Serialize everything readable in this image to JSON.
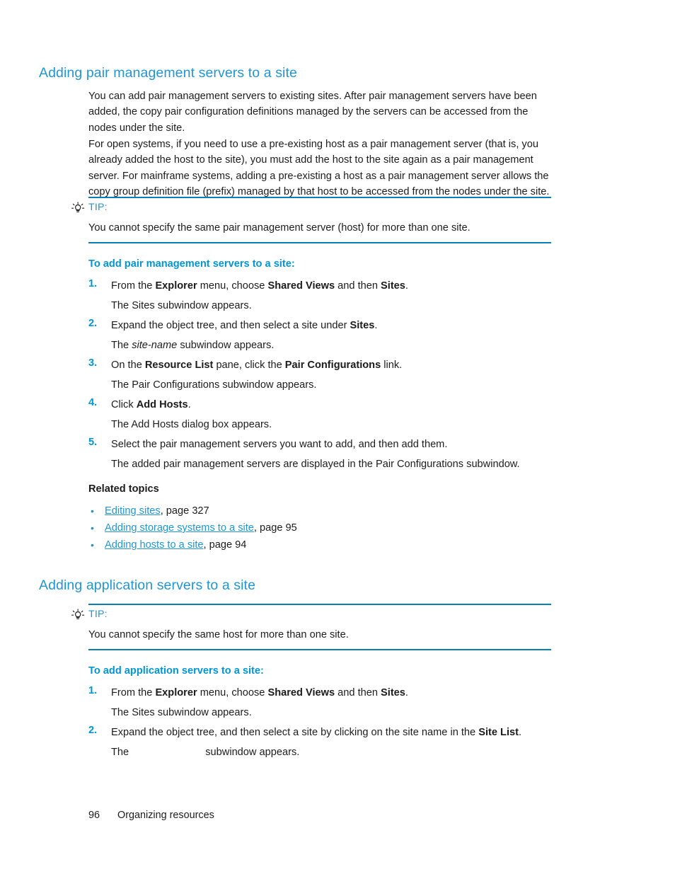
{
  "colors": {
    "heading_blue": "#2196d4",
    "accent_blue": "#0096d6",
    "rule_blue": "#0a7fb5",
    "body_text": "#1c1c1c"
  },
  "sections": [
    {
      "heading": "Adding pair management servers to a site",
      "paragraphs": [
        "You can add pair management servers to existing sites. After pair management servers have been added, the copy pair configuration definitions managed by the servers can be accessed from the nodes under the site.",
        "For open systems, if you need to use a pre-existing host as a pair management server (that is, you already added the host to the site), you must add the host to the site again as a pair management server. For mainframe systems, adding a pre-existing a host as a pair management server allows the copy group definition file (prefix) managed by that host to be accessed from the nodes under the site."
      ],
      "tip": {
        "icon": "lightbulb-icon",
        "label": "TIP:",
        "text": "You cannot specify the same pair management server (host) for more than one site."
      },
      "procedure_heading": "To add pair management servers to a site:",
      "steps": [
        {
          "number": "1.",
          "text_parts": [
            {
              "t": "From the ",
              "style": "normal"
            },
            {
              "t": "Explorer",
              "style": "bold"
            },
            {
              "t": " menu, choose ",
              "style": "normal"
            },
            {
              "t": "Shared Views",
              "style": "bold"
            },
            {
              "t": " and then ",
              "style": "normal"
            },
            {
              "t": "Sites",
              "style": "bold"
            },
            {
              "t": ".",
              "style": "normal"
            }
          ],
          "result_parts": [
            {
              "t": "The Sites subwindow appears.",
              "style": "normal"
            }
          ]
        },
        {
          "number": "2.",
          "text_parts": [
            {
              "t": "Expand the object tree, and then select a site under ",
              "style": "normal"
            },
            {
              "t": "Sites",
              "style": "bold"
            },
            {
              "t": ".",
              "style": "normal"
            }
          ],
          "result_parts": [
            {
              "t": "The ",
              "style": "normal"
            },
            {
              "t": "site-name",
              "style": "italic"
            },
            {
              "t": " subwindow appears.",
              "style": "normal"
            }
          ]
        },
        {
          "number": "3.",
          "text_parts": [
            {
              "t": "On the ",
              "style": "normal"
            },
            {
              "t": "Resource List",
              "style": "bold"
            },
            {
              "t": " pane, click the ",
              "style": "normal"
            },
            {
              "t": "Pair Configurations",
              "style": "bold"
            },
            {
              "t": " link.",
              "style": "normal"
            }
          ],
          "result_parts": [
            {
              "t": "The Pair Configurations subwindow appears.",
              "style": "normal"
            }
          ]
        },
        {
          "number": "4.",
          "text_parts": [
            {
              "t": "Click ",
              "style": "normal"
            },
            {
              "t": "Add Hosts",
              "style": "bold"
            },
            {
              "t": ".",
              "style": "normal"
            }
          ],
          "result_parts": [
            {
              "t": "The Add Hosts dialog box appears.",
              "style": "normal"
            }
          ]
        },
        {
          "number": "5.",
          "text_parts": [
            {
              "t": "Select the pair management servers you want to add, and then add them.",
              "style": "normal"
            }
          ],
          "result_parts": [
            {
              "t": "The added pair management servers are displayed in the Pair Configurations subwindow.",
              "style": "normal"
            }
          ]
        }
      ],
      "related": {
        "heading": "Related topics",
        "items": [
          {
            "bullet": "•",
            "link": "Editing sites",
            "suffix": ", page 327"
          },
          {
            "bullet": "•",
            "link": "Adding storage systems to a site",
            "suffix": ", page 95"
          },
          {
            "bullet": "•",
            "link": "Adding hosts to a site",
            "suffix": ", page 94"
          }
        ]
      }
    },
    {
      "heading": "Adding application servers to a site",
      "tip": {
        "icon": "lightbulb-icon",
        "label": "TIP:",
        "text": "You cannot specify the same host for more than one site."
      },
      "procedure_heading": "To add application servers to a site:",
      "steps": [
        {
          "number": "1.",
          "text_parts": [
            {
              "t": "From the ",
              "style": "normal"
            },
            {
              "t": "Explorer",
              "style": "bold"
            },
            {
              "t": " menu, choose ",
              "style": "normal"
            },
            {
              "t": "Shared Views",
              "style": "bold"
            },
            {
              "t": " and then ",
              "style": "normal"
            },
            {
              "t": "Sites",
              "style": "bold"
            },
            {
              "t": ".",
              "style": "normal"
            }
          ],
          "result_parts": [
            {
              "t": "The Sites subwindow appears.",
              "style": "normal"
            }
          ]
        },
        {
          "number": "2.",
          "text_parts": [
            {
              "t": "Expand the object tree, and then select a site by clicking on the site name in the ",
              "style": "normal"
            },
            {
              "t": "Site List",
              "style": "bold"
            },
            {
              "t": ".",
              "style": "normal"
            }
          ],
          "result_parts": [
            {
              "t": "The ",
              "style": "normal"
            },
            {
              "t": "",
              "style": "gap"
            },
            {
              "t": " subwindow appears.",
              "style": "normal"
            }
          ]
        }
      ]
    }
  ],
  "footer": {
    "page_number": "96",
    "chapter_title": "Organizing resources"
  }
}
